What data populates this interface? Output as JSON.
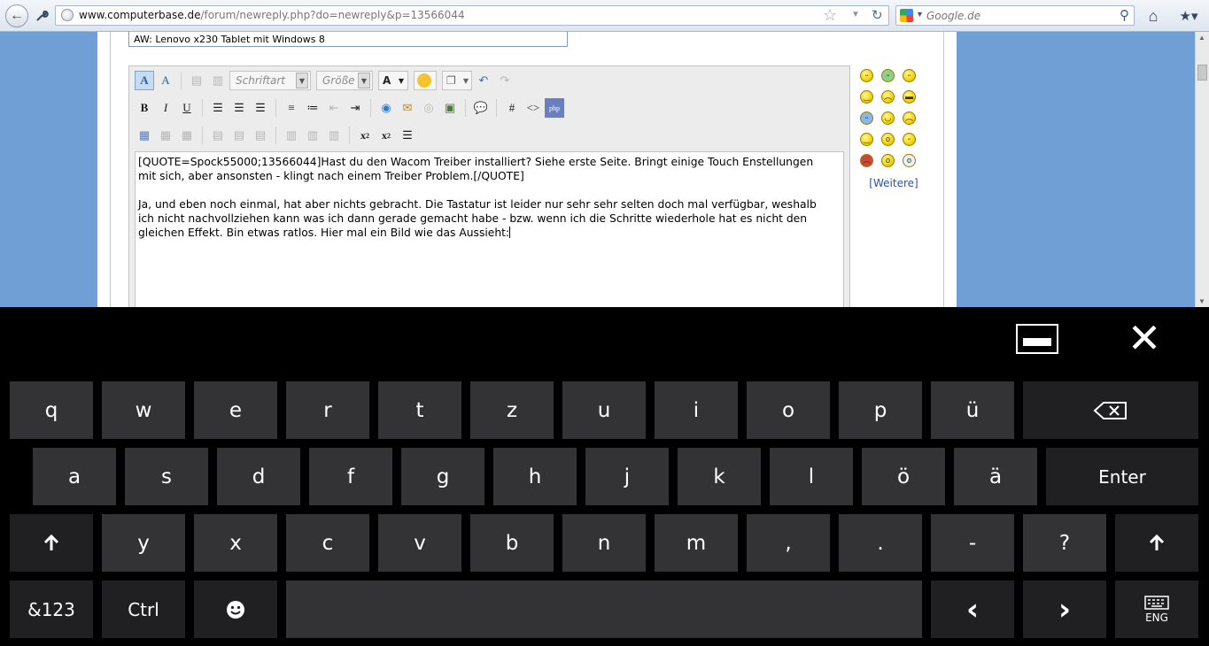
{
  "browser": {
    "url_domain": "www.computerbase.de",
    "url_path": "/forum/newreply.php?do=newreply&p=13566044",
    "search_placeholder": "Google.de"
  },
  "form": {
    "title_value": "AW: Lenovo x230 Tablet mit Windows 8",
    "toolbar": {
      "font_select": "Schriftart",
      "size_select": "Größe"
    },
    "message_lines": [
      "[QUOTE=Spock55000;13566044]Hast du den Wacom Treiber installiert? Siehe erste Seite. Bringt einige Touch Enstellungen",
      "mit sich, aber ansonsten - klingt nach einem Treiber Problem.[/QUOTE]",
      "",
      "Ja, und eben noch einmal, hat aber nichts gebracht. Die Tastatur ist leider nur sehr sehr selten doch mal verfügbar, weshalb",
      "ich nicht nachvollziehen kann was ich dann gerade gemacht habe - bzw. wenn ich die Schritte wiederhole hat es nicht den",
      "gleichen Effekt. Bin etwas ratlos. Hier mal ein Bild wie das Aussieht:"
    ],
    "smilies_more": "[Weitere]"
  },
  "keyboard": {
    "row1": [
      "q",
      "w",
      "e",
      "r",
      "t",
      "z",
      "u",
      "i",
      "o",
      "p",
      "ü"
    ],
    "row2": [
      "a",
      "s",
      "d",
      "f",
      "g",
      "h",
      "j",
      "k",
      "l",
      "ö",
      "ä"
    ],
    "row3": [
      "y",
      "x",
      "c",
      "v",
      "b",
      "n",
      "m",
      ",",
      ".",
      "-",
      "?"
    ],
    "enter": "Enter",
    "numbers": "&123",
    "ctrl": "Ctrl",
    "layout": "ENG",
    "backspace_icon": "backspace-icon",
    "shift_icon": "shift-arrow-icon",
    "emoji_icon": "smiley-icon",
    "arrow_left": "‹",
    "arrow_right": "›"
  }
}
